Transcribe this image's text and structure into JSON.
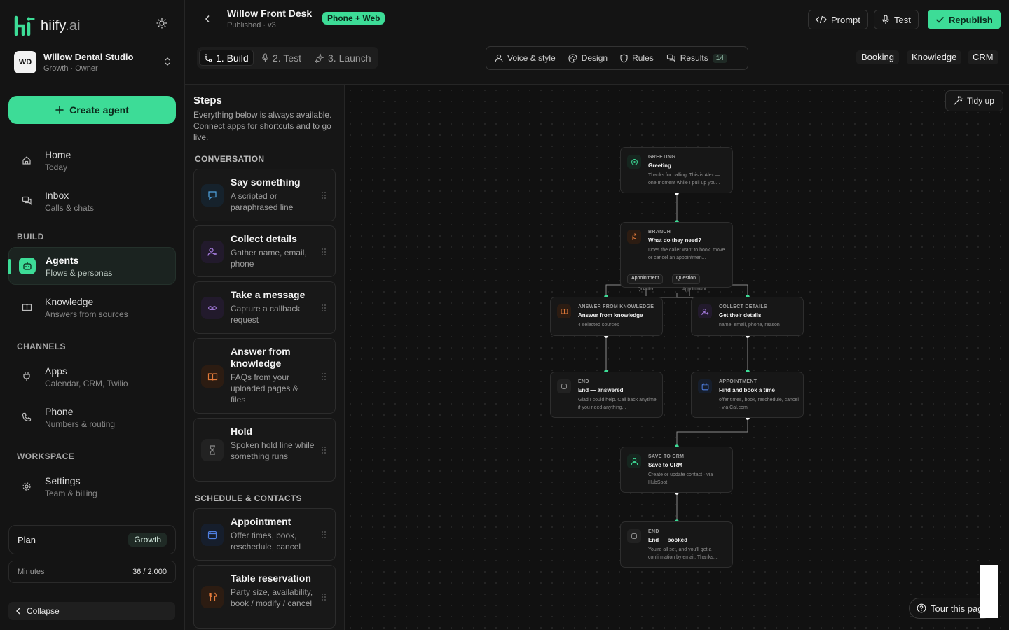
{
  "brand": {
    "name": "hiify",
    "tld": ".ai",
    "accent": "#3ddc97"
  },
  "workspace": {
    "initials": "WD",
    "name": "Willow Dental Studio",
    "subtitle": "Growth · Owner"
  },
  "sidebar": {
    "create_label": "Create agent",
    "items_top": [
      {
        "label": "Home",
        "sub": "Today",
        "icon": "home-icon"
      },
      {
        "label": "Inbox",
        "sub": "Calls & chats",
        "icon": "chat-icon"
      }
    ],
    "section_build": "BUILD",
    "items_build": [
      {
        "label": "Agents",
        "sub": "Flows & personas",
        "icon": "robot-icon"
      },
      {
        "label": "Knowledge",
        "sub": "Answers from sources",
        "icon": "book-icon"
      }
    ],
    "section_channels": "CHANNELS",
    "items_channels": [
      {
        "label": "Apps",
        "sub": "Calendar, CRM, Twilio",
        "icon": "plug-icon"
      },
      {
        "label": "Phone",
        "sub": "Numbers & routing",
        "icon": "phone-icon"
      }
    ],
    "section_workspace": "WORKSPACE",
    "items_workspace": [
      {
        "label": "Settings",
        "sub": "Team & billing",
        "icon": "gear-icon"
      }
    ],
    "plan_label": "Plan",
    "plan_value": "Growth",
    "minutes_label": "Minutes",
    "minutes_value": "36 / 2,000",
    "collapse_label": "Collapse"
  },
  "header": {
    "title": "Willow Front Desk",
    "subtitle": "Published  · v3",
    "channel": "Phone + Web",
    "prompt_label": "Prompt",
    "test_label": "Test",
    "republish_label": "Republish"
  },
  "stepper": [
    {
      "label": "1. Build",
      "active": true
    },
    {
      "label": "2. Test",
      "active": false
    },
    {
      "label": "3. Launch",
      "active": false
    }
  ],
  "config": {
    "voice": "Voice & style",
    "design": "Design",
    "rules": "Rules",
    "results": "Results",
    "results_count": "14"
  },
  "tags": [
    "Booking",
    "Knowledge",
    "CRM"
  ],
  "palette": {
    "title": "Steps",
    "description": "Everything below is always available. Connect apps for shortcuts and to go live.",
    "section_conversation": "CONVERSATION",
    "conversation": [
      {
        "title": "Say something",
        "desc": "A scripted or paraphrased line"
      },
      {
        "title": "Collect details",
        "desc": "Gather name, email, phone"
      },
      {
        "title": "Take a message",
        "desc": "Capture a callback request"
      },
      {
        "title": "Answer from knowledge",
        "desc": "FAQs from your uploaded pages & files"
      },
      {
        "title": "Hold",
        "desc": "Spoken hold line while something runs"
      }
    ],
    "section_schedule": "SCHEDULE & CONTACTS",
    "schedule": [
      {
        "title": "Appointment",
        "desc": "Offer times, book, reschedule, cancel"
      },
      {
        "title": "Table reservation",
        "desc": "Party size, availability, book / modify / cancel"
      }
    ]
  },
  "canvas": {
    "tidy_label": "Tidy up",
    "tour_label": "Tour this page",
    "nodes": {
      "greeting": {
        "kind": "GREETING",
        "title": "Greeting",
        "desc": "Thanks for calling. This is Alex — one moment while I pull up you..."
      },
      "branch": {
        "kind": "BRANCH",
        "title": "What do they need?",
        "desc": "Does the caller want to book, move or cancel an appointmen..."
      },
      "knowledge": {
        "kind": "ANSWER FROM KNOWLEDGE",
        "title": "Answer from knowledge",
        "desc": "4 selected sources"
      },
      "collect": {
        "kind": "COLLECT DETAILS",
        "title": "Get their details",
        "desc": "name, email, phone, reason"
      },
      "end_answered": {
        "kind": "END",
        "title": "End — answered",
        "desc": "Glad I could help. Call back anytime if you need anything..."
      },
      "appointment": {
        "kind": "APPOINTMENT",
        "title": "Find and book a time",
        "desc": "offer times, book, reschedule, cancel · via Cal.com"
      },
      "crm": {
        "kind": "SAVE TO CRM",
        "title": "Save to CRM",
        "desc": "Create or update contact · via HubSpot"
      },
      "end_booked": {
        "kind": "END",
        "title": "End — booked",
        "desc": "You're all set, and you'll get a confirmation by email. Thanks..."
      }
    },
    "branch_options": [
      "Appointment",
      "Question"
    ],
    "edge_labels": [
      "Question",
      "Appointment"
    ]
  }
}
